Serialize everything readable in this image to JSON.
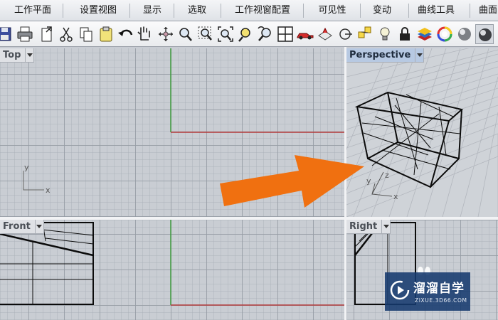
{
  "tabs": [
    {
      "label": "工作平面"
    },
    {
      "label": "设置视图"
    },
    {
      "label": "显示"
    },
    {
      "label": "选取"
    },
    {
      "label": "工作视窗配置"
    },
    {
      "label": "可见性"
    },
    {
      "label": "变动"
    },
    {
      "label": "曲线工具"
    },
    {
      "label": "曲面"
    }
  ],
  "toolbar": {
    "icons": [
      "save-icon",
      "print-icon",
      "import-icon",
      "cut-icon",
      "copy-icon",
      "paste-icon",
      "undo-icon",
      "pan-hand-icon",
      "rotate-view-icon",
      "zoom-icon",
      "zoom-window-icon",
      "zoom-extents-icon",
      "zoom-selected-icon",
      "zoom-previous-icon",
      "four-viewports-icon",
      "car-icon",
      "layer-icon",
      "object-snap-icon",
      "point-icon",
      "light-bulb-icon",
      "lock-icon",
      "layers-stack-icon",
      "color-wheel-icon",
      "shaded-sphere-icon",
      "rendered-sphere-icon",
      "material-sphere-icon",
      "ghosted-sphere-icon"
    ]
  },
  "viewports": {
    "top": {
      "title": "Top",
      "axis_x": "x",
      "axis_y": "y"
    },
    "perspective": {
      "title": "Perspective",
      "axis_x": "x",
      "axis_y": "y",
      "axis_z": "z"
    },
    "front": {
      "title": "Front"
    },
    "right": {
      "title": "Right"
    }
  },
  "colors": {
    "x_axis": "#b33a3a",
    "y_axis": "#3c9a3c",
    "arrow": "#f07010",
    "active_title": "#b7c9e2"
  },
  "watermark": {
    "name": "溜溜自学",
    "url": "ZIXUE.3D66.COM"
  }
}
